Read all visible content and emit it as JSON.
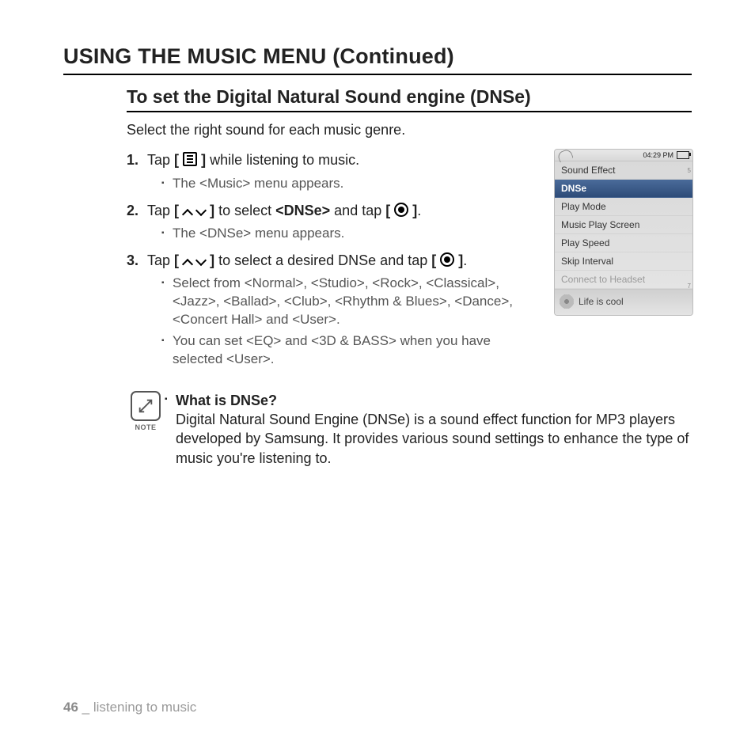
{
  "title": "USING THE MUSIC MENU (Continued)",
  "subtitle": "To set the Digital Natural Sound engine (DNSe)",
  "intro": "Select the right sound for each music genre.",
  "steps": [
    {
      "num": "1.",
      "pre": "Tap ",
      "post": " while listening to music.",
      "bullets": [
        "The <Music> menu appears."
      ]
    },
    {
      "num": "2.",
      "pre": "Tap ",
      "mid1": " to select ",
      "bold1": "<DNSe>",
      "mid2": " and tap ",
      "post": ".",
      "bullets": [
        "The <DNSe> menu appears."
      ]
    },
    {
      "num": "3.",
      "pre": "Tap ",
      "mid1": " to select a desired DNSe and tap ",
      "post": ".",
      "bullets": [
        "Select from <Normal>, <Studio>, <Rock>, <Classical>, <Jazz>, <Ballad>, <Club>, <Rhythm & Blues>, <Dance>, <Concert Hall>  and <User>.",
        "You can set <EQ> and <3D & BASS> when you have selected <User>."
      ]
    }
  ],
  "note": {
    "label": "NOTE",
    "title": "What is DNSe?",
    "body": "Digital Natural Sound Engine (DNSe) is a sound effect function for MP3 players developed by Samsung. It provides various sound settings to enhance the type of music you're listening to."
  },
  "footer": {
    "page": "46",
    "sep": " _ ",
    "section": "listening to music"
  },
  "device": {
    "time": "04:29 PM",
    "menu": [
      {
        "label": "Sound Effect",
        "sel": false,
        "dis": false
      },
      {
        "label": "DNSe",
        "sel": true,
        "dis": false
      },
      {
        "label": "Play Mode",
        "sel": false,
        "dis": false
      },
      {
        "label": "Music Play Screen",
        "sel": false,
        "dis": false
      },
      {
        "label": "Play Speed",
        "sel": false,
        "dis": false
      },
      {
        "label": "Skip Interval",
        "sel": false,
        "dis": false
      },
      {
        "label": "Connect to Headset",
        "sel": false,
        "dis": true
      }
    ],
    "side_numbers": [
      "5",
      "7"
    ],
    "nowplaying": "Life is cool"
  }
}
